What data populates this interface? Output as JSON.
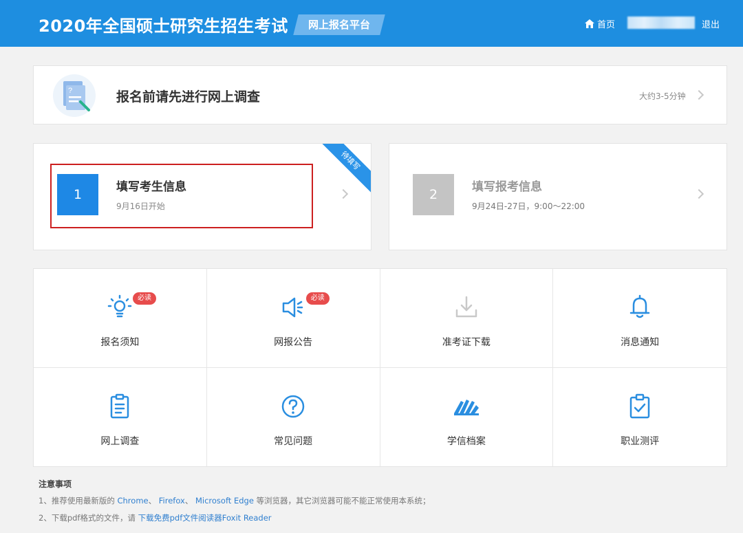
{
  "header": {
    "site_title": "2020年全国硕士研究生招生考试",
    "platform_tag": "网上报名平台",
    "home_label": "首页",
    "logout_label": "退出"
  },
  "survey": {
    "title": "报名前请先进行网上调查",
    "duration": "大约3-5分钟"
  },
  "steps": [
    {
      "number": "1",
      "title": "填写考生信息",
      "date": "9月16日开始",
      "ribbon": "待填写"
    },
    {
      "number": "2",
      "title": "填写报考信息",
      "date": "9月24日-27日，9:00～22:00"
    }
  ],
  "grid": [
    {
      "label": "报名须知",
      "icon": "lightbulb-icon",
      "badge": "必读"
    },
    {
      "label": "网报公告",
      "icon": "megaphone-icon",
      "badge": "必读"
    },
    {
      "label": "准考证下载",
      "icon": "download-icon"
    },
    {
      "label": "消息通知",
      "icon": "bell-icon"
    },
    {
      "label": "网上调查",
      "icon": "clipboard-list-icon"
    },
    {
      "label": "常见问题",
      "icon": "question-circle-icon"
    },
    {
      "label": "学信档案",
      "icon": "archive-icon"
    },
    {
      "label": "职业测评",
      "icon": "clipboard-check-icon"
    }
  ],
  "notes": {
    "title": "注意事项",
    "line1": {
      "prefix": "1、推荐使用最新版的",
      "chrome": "Chrome",
      "sep1": "、",
      "firefox": "Firefox",
      "sep2": "、",
      "edge": "Microsoft Edge",
      "suffix": "等浏览器，其它浏览器可能不能正常使用本系统；"
    },
    "line2": {
      "prefix": "2、下载pdf格式的文件，请",
      "link": "下载免费pdf文件阅读器Foxit Reader"
    }
  },
  "colors": {
    "brand": "#1e8ee0",
    "step_active": "#1e88e5",
    "step_inactive": "#c4c4c4",
    "badge": "#e74c4c",
    "highlight": "#cc1f1f",
    "link": "#2f7fcf"
  }
}
